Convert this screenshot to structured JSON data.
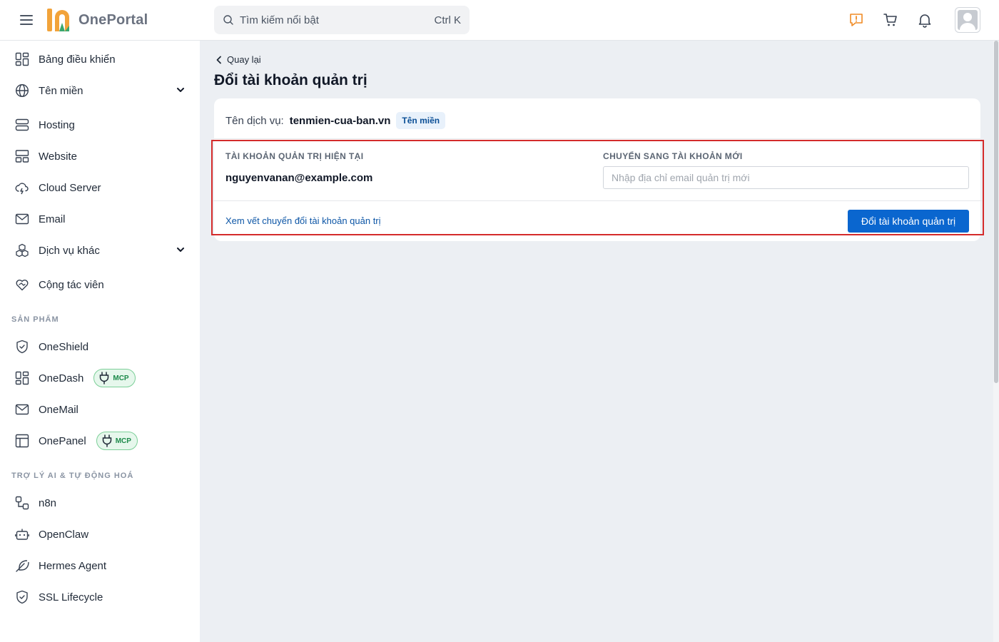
{
  "header": {
    "brand": "OnePortal",
    "search_placeholder": "Tìm kiếm nổi bật",
    "search_shortcut": "Ctrl K",
    "accent": "#f08a24"
  },
  "sidebar": {
    "items": [
      {
        "label": "Bảng điều khiển"
      },
      {
        "label": "Tên miền"
      },
      {
        "label": "Hosting"
      },
      {
        "label": "Website"
      },
      {
        "label": "Cloud Server"
      },
      {
        "label": "Email"
      },
      {
        "label": "Dịch vụ khác"
      },
      {
        "label": "Cộng tác viên"
      }
    ],
    "section_products": "SẢN PHẨM",
    "products": [
      {
        "label": "OneShield"
      },
      {
        "label": "OneDash",
        "badge": "MCP"
      },
      {
        "label": "OneMail"
      },
      {
        "label": "OnePanel",
        "badge": "MCP"
      }
    ],
    "section_ai": "TRỢ LÝ AI & TỰ ĐỘNG HOÁ",
    "ai": [
      {
        "label": "n8n"
      },
      {
        "label": "OpenClaw"
      },
      {
        "label": "Hermes Agent"
      },
      {
        "label": "SSL Lifecycle"
      }
    ]
  },
  "main": {
    "back_label": "Quay lại",
    "title": "Đổi tài khoản quản trị",
    "service_key": "Tên dịch vụ:",
    "service_value": "tenmien-cua-ban.vn",
    "service_badge": "Tên miền",
    "current_heading": "TÀI KHOẢN QUẢN TRỊ HIỆN TẠI",
    "current_email": "nguyenvanan@example.com",
    "new_heading": "CHUYỂN SANG TÀI KHOẢN MỚI",
    "new_placeholder": "Nhập địa chỉ email quản trị mới",
    "history_link": "Xem vết chuyển đổi tài khoản quản trị",
    "submit_label": "Đổi tài khoản quản trị"
  }
}
